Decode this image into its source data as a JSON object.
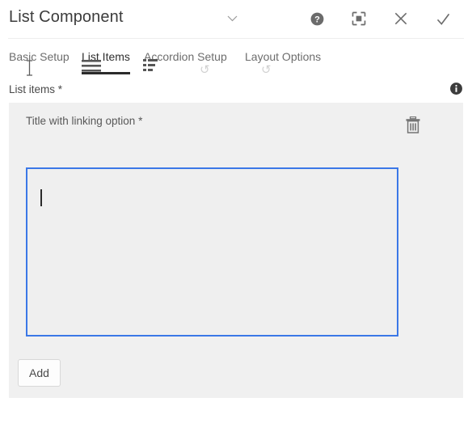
{
  "header": {
    "title": "List Component",
    "actions": [
      {
        "name": "help-icon",
        "label": "Help"
      },
      {
        "name": "fullscreen-icon",
        "label": "Fullscreen"
      },
      {
        "name": "close-icon",
        "label": "Close"
      },
      {
        "name": "confirm-icon",
        "label": "Done"
      }
    ]
  },
  "tabs": [
    {
      "label": "Basic Setup",
      "active": false
    },
    {
      "label": "List Items",
      "active": true
    },
    {
      "label": "Accordion Setup",
      "active": false
    },
    {
      "label": "Layout Options",
      "active": false
    }
  ],
  "field": {
    "label": "List items *",
    "info_icon": "info-icon"
  },
  "item": {
    "title": "Title with linking option *",
    "delete_icon": "trash-icon",
    "editor_value": "",
    "editor_placeholder": ""
  },
  "buttons": {
    "add_label": "Add"
  },
  "colors": {
    "focus_border": "#3b78e7",
    "panel_background": "#f0f0f0",
    "active_tab_underline": "#2b2b2b",
    "text_primary": "#3c3c3c",
    "text_muted": "#6d6d6d"
  }
}
